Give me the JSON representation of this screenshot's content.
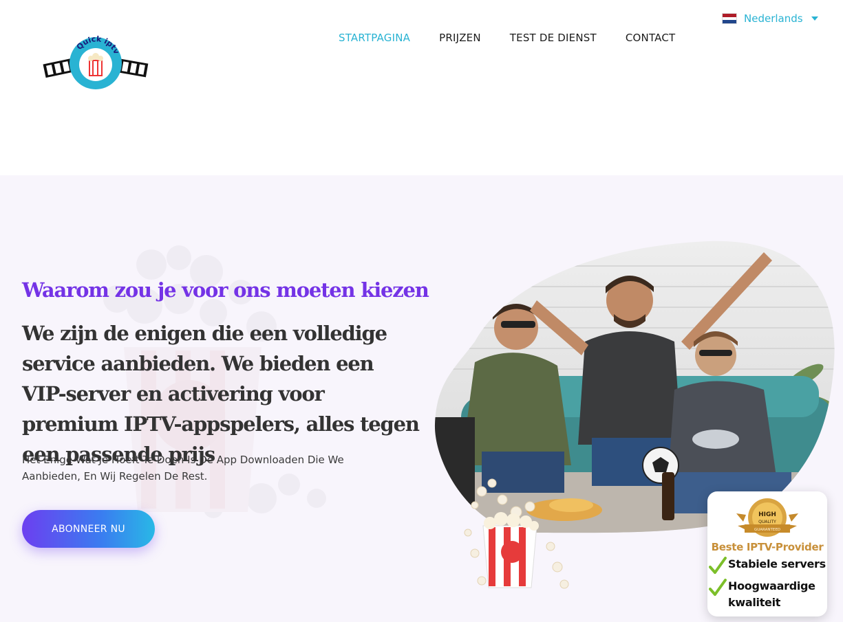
{
  "header": {
    "logo_text": "Quick iptv",
    "nav": [
      {
        "label": "STARTPAGINA",
        "active": true
      },
      {
        "label": "PRIJZEN",
        "active": false
      },
      {
        "label": "TEST DE DIENST",
        "active": false
      },
      {
        "label": "CONTACT",
        "active": false
      }
    ],
    "language": "Nederlands"
  },
  "hero": {
    "subtitle": "Waarom zou je voor ons moeten kiezen",
    "headline": "We zijn de enigen die een volledige service aanbieden. We bieden een VIP-server en activering voor premium IPTV-appspelers, alles tegen een passende prijs",
    "description": "Het Enige Wat Je Hoeft Te Doen Is De App Downloaden Die We Aanbieden, En Wij Regelen De Rest.",
    "cta_label": "ABONNEER NU"
  },
  "badge": {
    "medal_line1": "HIGH",
    "medal_line2": "QUALITY",
    "medal_line3": "GUARANTEED",
    "title": "Beste IPTV-Provider",
    "items": [
      "Stabiele servers",
      "Hoogwaardige kwaliteit"
    ]
  },
  "colors": {
    "accent": "#29b3d3",
    "purple": "#7433e6",
    "hero_bg": "#f8f5fc",
    "gold": "#c8903a"
  },
  "icons": {
    "logo": "quick-iptv-logo-icon",
    "flag": "netherlands-flag-icon",
    "caret": "caret-down-icon",
    "check": "check-icon",
    "medal": "medal-icon"
  }
}
